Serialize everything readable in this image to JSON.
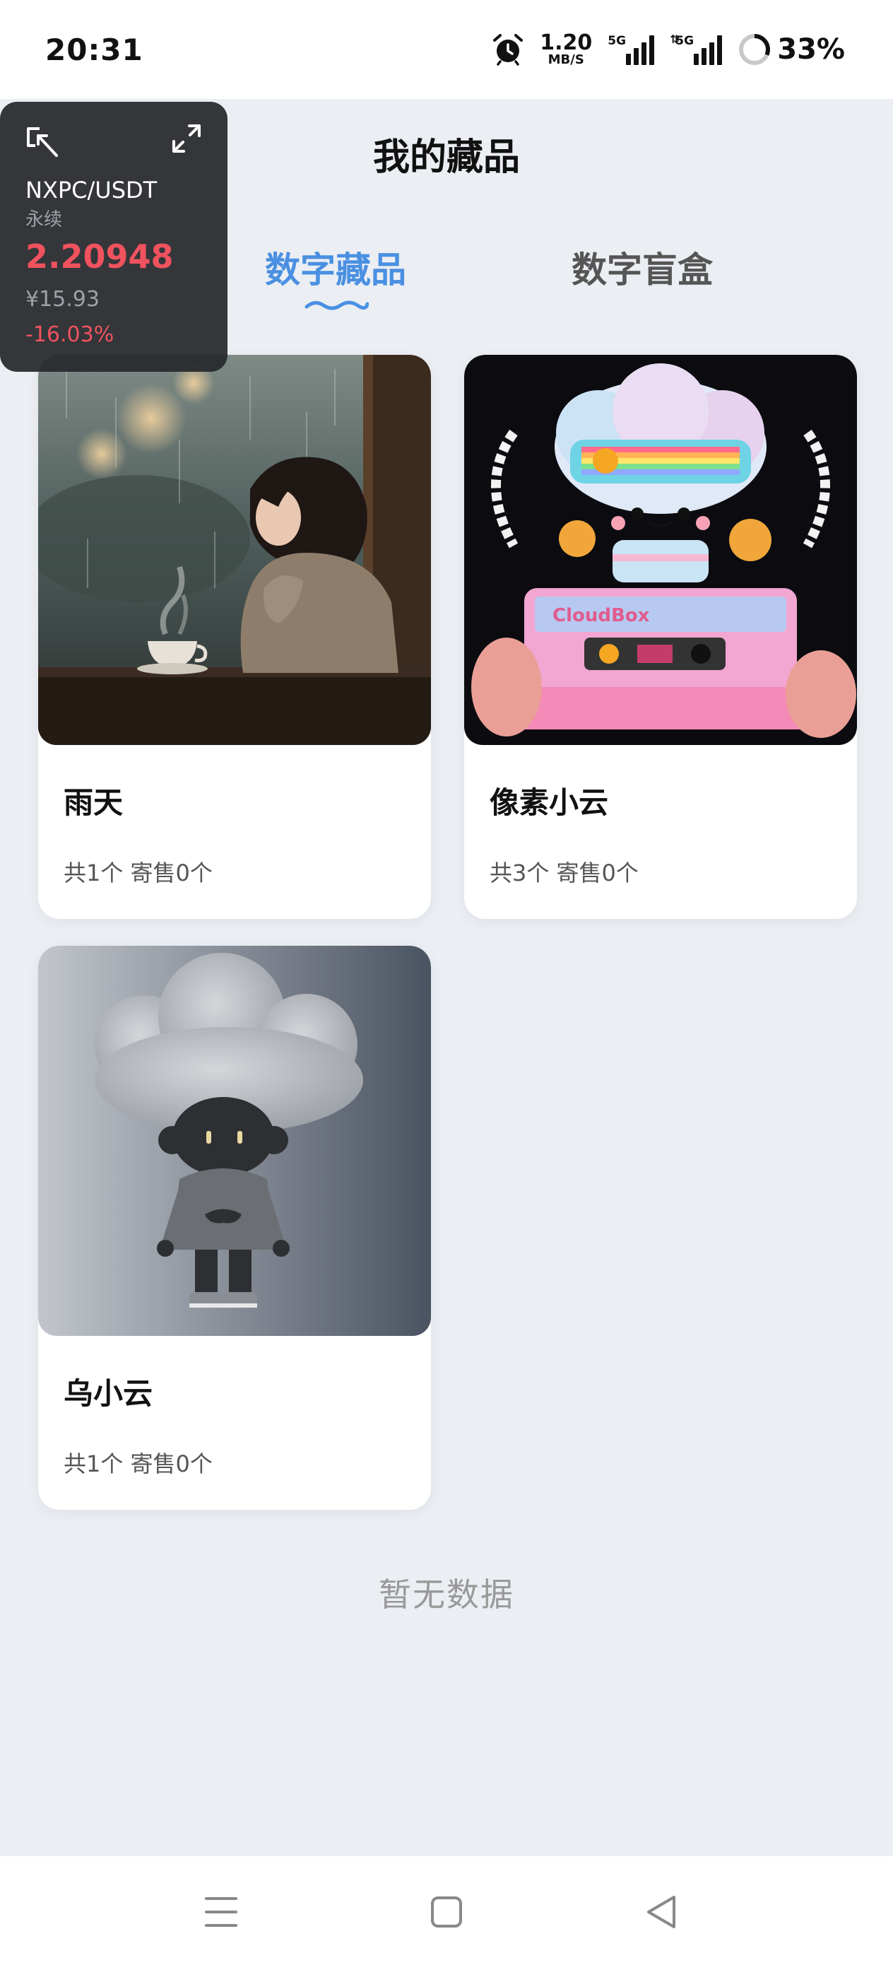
{
  "status_bar": {
    "time": "20:31",
    "net_speed_value": "1.20",
    "net_speed_unit": "MB/S",
    "signal1_label": "5G",
    "signal2_label": "5G",
    "battery": "33%",
    "icons": [
      "alarm-icon",
      "signal-icon",
      "battery-ring-icon"
    ]
  },
  "header": {
    "title": "我的藏品"
  },
  "tabs": [
    {
      "label": "数字藏品",
      "active": true
    },
    {
      "label": "数字盲盒",
      "active": false
    }
  ],
  "collections": [
    {
      "name": "雨天",
      "meta": "共1个 寄售0个"
    },
    {
      "name": "像素小云",
      "meta": "共3个 寄售0个"
    },
    {
      "name": "乌小云",
      "meta": "共1个 寄售0个"
    }
  ],
  "empty_text": "暂无数据",
  "ticker": {
    "pair": "NXPC/USDT",
    "type": "永续",
    "price": "2.20948",
    "fiat": "¥15.93",
    "change": "-16.03%",
    "accent_color": "#f0525e"
  },
  "colors": {
    "accent": "#4a90e2",
    "background": "#ebeef3"
  },
  "nav": [
    "menu-icon",
    "home-icon",
    "back-icon"
  ]
}
